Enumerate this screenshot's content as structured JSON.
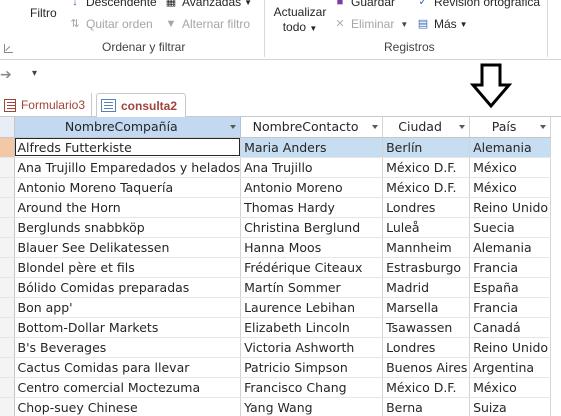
{
  "ribbon": {
    "filtro": "Filtro",
    "descendente": "Descendente",
    "quitar_orden": "Quitar orden",
    "avanzadas": "Avanzadas",
    "alternar_filtro": "Alternar filtro",
    "group_ordenar": "Ordenar y filtrar",
    "actualizar_line1": "Actualizar",
    "actualizar_line2": "todo",
    "guardar": "Guardar",
    "eliminar": "Eliminar",
    "mas": "Más",
    "revision": "Revisión ortográfica",
    "group_registros": "Registros"
  },
  "tabs": [
    {
      "label": "Formulario3"
    },
    {
      "label": "consulta2"
    }
  ],
  "table": {
    "columns": [
      "NombreCompañía",
      "NombreContacto",
      "Ciudad",
      "País"
    ],
    "rows": [
      [
        "Alfreds Futterkiste",
        "Maria Anders",
        "Berlín",
        "Alemania"
      ],
      [
        "Ana Trujillo Emparedados y helados",
        "Ana Trujillo",
        "México D.F.",
        "México"
      ],
      [
        "Antonio Moreno Taquería",
        "Antonio Moreno",
        "México D.F.",
        "México"
      ],
      [
        "Around the Horn",
        "Thomas Hardy",
        "Londres",
        "Reino Unido"
      ],
      [
        "Berglunds snabbköp",
        "Christina Berglund",
        "Luleå",
        "Suecia"
      ],
      [
        "Blauer See Delikatessen",
        "Hanna Moos",
        "Mannheim",
        "Alemania"
      ],
      [
        "Blondel père et fils",
        "Frédérique Citeaux",
        "Estrasburgo",
        "Francia"
      ],
      [
        "Bólido Comidas preparadas",
        "Martín Sommer",
        "Madrid",
        "España"
      ],
      [
        "Bon app'",
        "Laurence Lebihan",
        "Marsella",
        "Francia"
      ],
      [
        "Bottom-Dollar Markets",
        "Elizabeth Lincoln",
        "Tsawassen",
        "Canadá"
      ],
      [
        "B's Beverages",
        "Victoria Ashworth",
        "Londres",
        "Reino Unido"
      ],
      [
        "Cactus Comidas para llevar",
        "Patricio Simpson",
        "Buenos Aires",
        "Argentina"
      ],
      [
        "Centro comercial Moctezuma",
        "Francisco Chang",
        "México D.F.",
        "México"
      ],
      [
        "Chop-suey Chinese",
        "Yang Wang",
        "Berna",
        "Suiza"
      ]
    ]
  }
}
